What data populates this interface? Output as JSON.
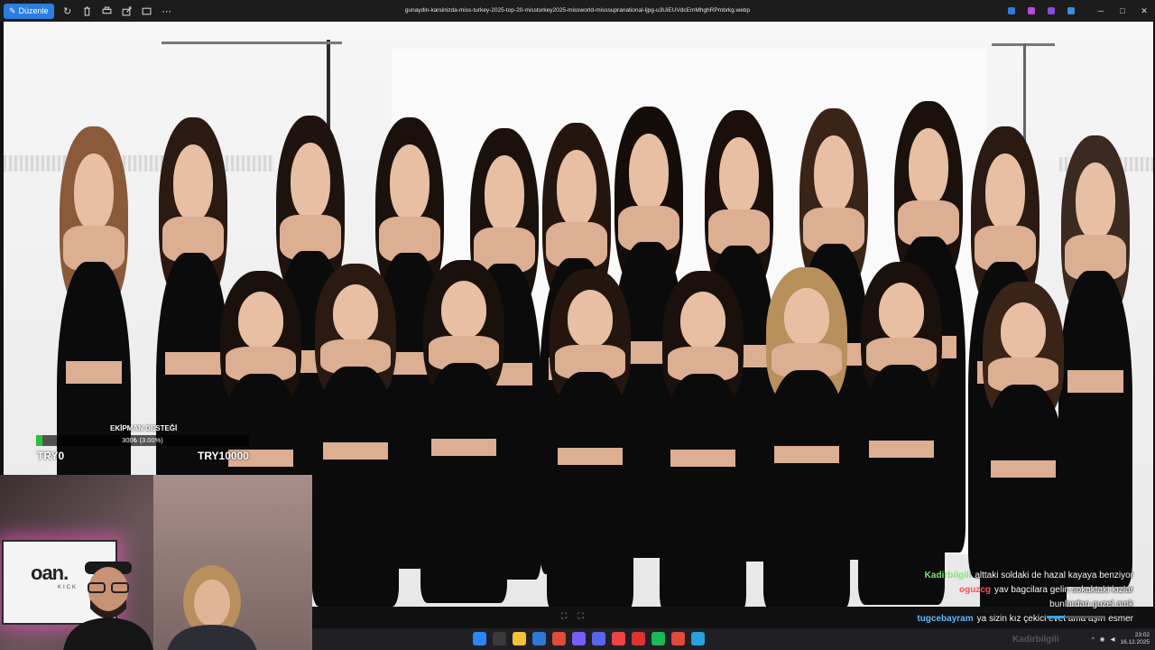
{
  "toolbar": {
    "edit_label": "Düzenle",
    "icons": [
      "rotate-icon",
      "delete-icon",
      "print-icon",
      "share-icon",
      "fit-icon",
      "more-icon"
    ],
    "filename": "gunaydin-karsinizda-miss-turkey-2025-top-20-missturkey2025-missworld-misssupranational-ljpg-u3UiEUVdcEmMhghRPmbrkg.webp",
    "window_controls": [
      "─",
      "□",
      "✕"
    ]
  },
  "donation": {
    "title": "EKİPMAN DESTEĞİ",
    "amount": "300₺ (3.00%)",
    "progress": 0.03,
    "min": "TRY0",
    "max": "TRY10000",
    "color": "#27c43a"
  },
  "webcam": {
    "logo": "oan.",
    "logo_sub": "KICK"
  },
  "chat": [
    {
      "user": "Kadirbilgili",
      "color": "#7de37a",
      "message": "alttaki soldaki de hazal kayaya benziyor"
    },
    {
      "user": "oguzcg",
      "color": "#ff4f5e",
      "message": "yav bagcilara gelin sokaktaki kızlar"
    },
    {
      "user": "",
      "color": "#ffffff",
      "message": "bunlardan guzel amk"
    },
    {
      "user": "tugcebayram",
      "color": "#5fb8ff",
      "message": "ya sizin kız çekici evet ama aşırı esmer"
    }
  ],
  "zoom": {
    "fit_label": "⛶",
    "actual_label": "⛶"
  },
  "taskbar": {
    "tray_user": "Kadirbilgili",
    "time": "23:02",
    "date": "16.12.2025",
    "app_colors": [
      "#2b86ff",
      "#3a3a3a",
      "#f3c13a",
      "#2d7ad6",
      "#e04b3a",
      "#7c5cff",
      "#5865f2",
      "#e44",
      "#d33",
      "#1db954",
      "#e04b3a",
      "#29a1e0"
    ]
  }
}
